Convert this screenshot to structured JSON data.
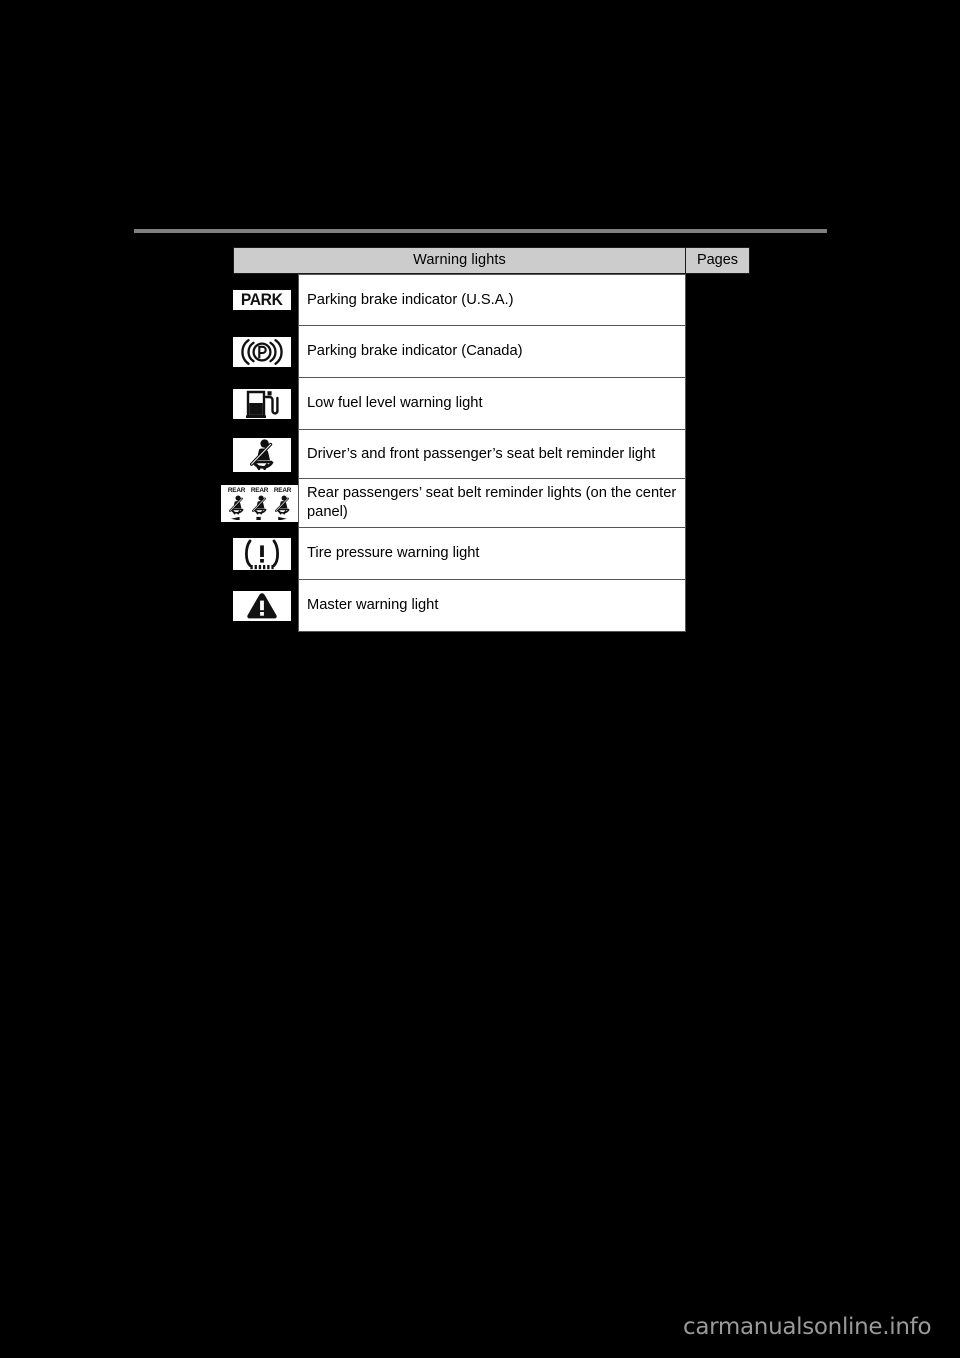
{
  "page": {
    "background_color": "#000000",
    "rule_color": "#808080"
  },
  "table": {
    "header": {
      "warning_lights_label": "Warning lights",
      "pages_label": "Pages",
      "background_color": "#cccccc"
    },
    "rows": [
      {
        "icon": "park-text-indicator-icon",
        "icon_text": "PARK",
        "description": "Parking brake indicator (U.S.A.)",
        "page_ref": ""
      },
      {
        "icon": "parking-brake-circle-p-icon",
        "icon_text": "",
        "description": "Parking brake indicator (Canada)",
        "page_ref": ""
      },
      {
        "icon": "fuel-pump-icon",
        "icon_text": "",
        "description": "Low fuel level warning light",
        "page_ref": ""
      },
      {
        "icon": "seat-belt-reminder-icon",
        "icon_text": "",
        "description": "Driver’s and front passenger’s seat belt reminder light",
        "page_ref": ""
      },
      {
        "icon": "rear-seat-belt-reminder-icon",
        "icon_text": "REAR",
        "description": "Rear passengers’ seat belt reminder lights (on the center panel)",
        "page_ref": ""
      },
      {
        "icon": "tire-pressure-warning-icon",
        "icon_text": "",
        "description": "Tire pressure warning light",
        "page_ref": ""
      },
      {
        "icon": "master-warning-triangle-icon",
        "icon_text": "",
        "description": "Master warning light",
        "page_ref": ""
      }
    ]
  },
  "watermark": {
    "text": "carmanualsonline.info",
    "color": "#9a9a9a"
  }
}
